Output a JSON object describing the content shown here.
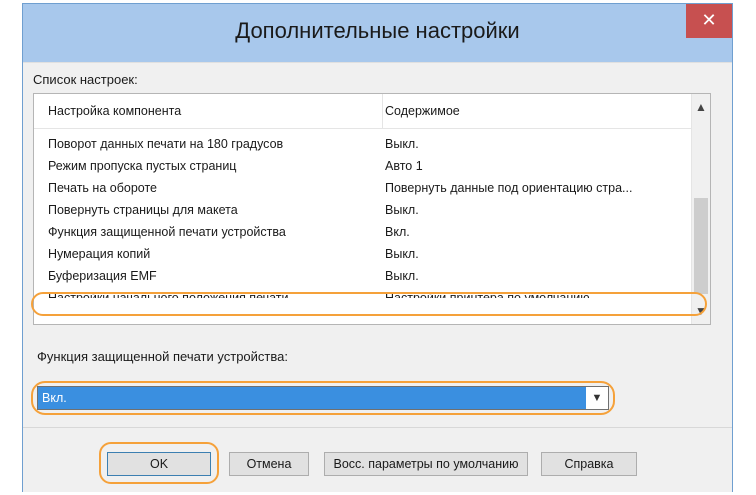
{
  "dialog": {
    "title": "Дополнительные настройки",
    "close_glyph": "✕"
  },
  "settings_list": {
    "label": "Список настроек:",
    "headers": [
      "Настройка компонента",
      "Содержимое"
    ],
    "rows": [
      {
        "name": "Поворот данных печати на 180 градусов",
        "value": "Выкл."
      },
      {
        "name": "Режим пропуска пустых страниц",
        "value": "Авто 1"
      },
      {
        "name": "Печать на обороте",
        "value": "Повернуть данные под ориентацию стра..."
      },
      {
        "name": "Повернуть страницы для макета",
        "value": "Выкл."
      },
      {
        "name": "Функция защищенной печати устройства",
        "value": "Вкл."
      },
      {
        "name": "Нумерация копий",
        "value": "Выкл."
      },
      {
        "name": "Буферизация EMF",
        "value": "Выкл."
      },
      {
        "name": "Настройки начального положения печати",
        "value": "Настройки принтера по умолчанию"
      }
    ],
    "highlighted_row": 4,
    "scroll_up": "▲",
    "scroll_down": "▼"
  },
  "setting_detail": {
    "label": "Функция защищенной печати устройства:",
    "selected_value": "Вкл.",
    "arrow": "▼"
  },
  "buttons": {
    "ok": "OK",
    "cancel": "Отмена",
    "restore_defaults": "Восс. параметры по умолчанию",
    "help": "Справка"
  },
  "colors": {
    "highlight_outline": "#f5a13a",
    "selection": "#3a8fe0",
    "close_button": "#c75050"
  }
}
